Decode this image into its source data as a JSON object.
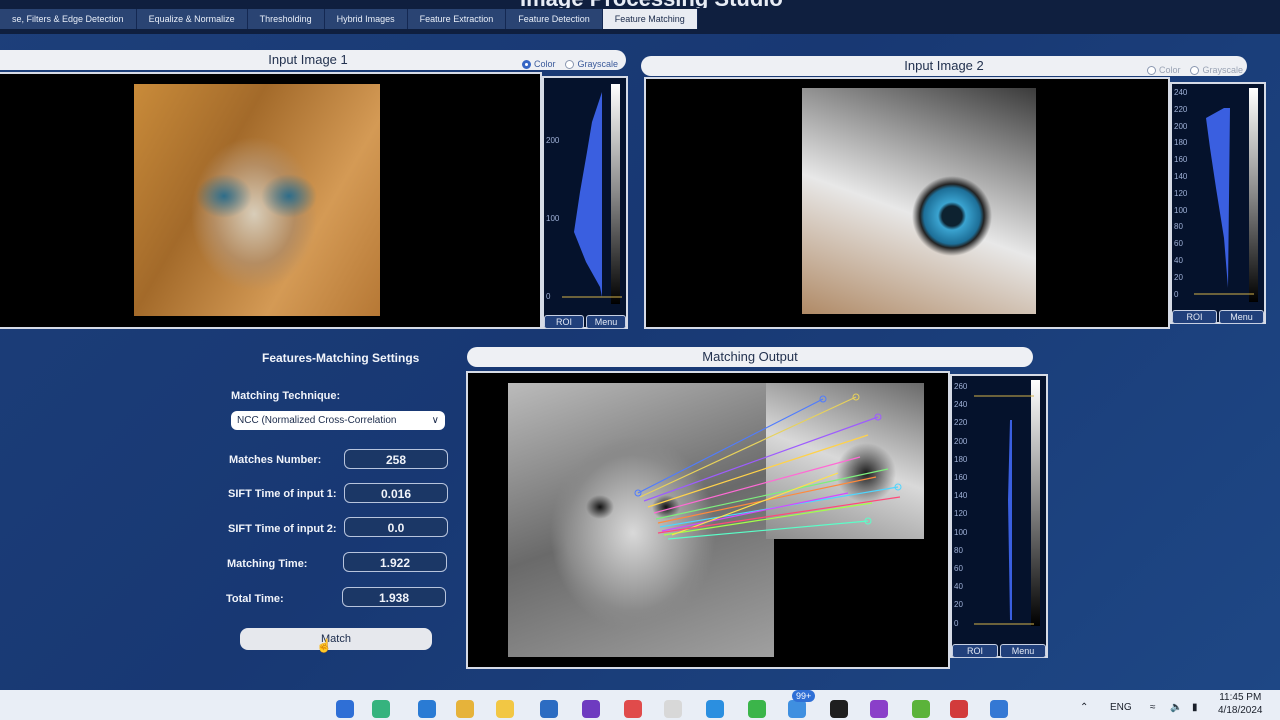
{
  "app": {
    "title": "Image Processing Studio"
  },
  "tabs": [
    {
      "label": "se, Filters & Edge Detection"
    },
    {
      "label": "Equalize & Normalize"
    },
    {
      "label": "Thresholding"
    },
    {
      "label": "Hybrid Images"
    },
    {
      "label": "Feature Extraction"
    },
    {
      "label": "Feature Detection"
    },
    {
      "label": "Feature Matching"
    }
  ],
  "input1": {
    "title": "Input Image 1",
    "color_label": "Color",
    "grayscale_label": "Grayscale",
    "histo_ticks": [
      "200",
      "100",
      "0"
    ],
    "roi_label": "ROI",
    "menu_label": "Menu"
  },
  "input2": {
    "title": "Input Image 2",
    "color_label": "Color",
    "grayscale_label": "Grayscale",
    "histo_ticks": [
      "240",
      "220",
      "200",
      "180",
      "160",
      "140",
      "120",
      "100",
      "80",
      "60",
      "40",
      "20",
      "0"
    ],
    "roi_label": "ROI",
    "menu_label": "Menu"
  },
  "settings": {
    "title": "Features-Matching Settings",
    "technique_label": "Matching Technique:",
    "technique_value": "NCC (Normalized Cross-Correlation",
    "matches_label": "Matches Number:",
    "matches_value": "258",
    "sift1_label": "SIFT Time of input 1:",
    "sift1_value": "0.016",
    "sift2_label": "SIFT Time of input 2:",
    "sift2_value": "0.0",
    "matching_time_label": "Matching Time:",
    "matching_time_value": "1.922",
    "total_time_label": "Total Time:",
    "total_time_value": "1.938",
    "match_button": "Match"
  },
  "output": {
    "title": "Matching Output",
    "histo_ticks": [
      "260",
      "240",
      "220",
      "200",
      "180",
      "160",
      "140",
      "120",
      "100",
      "80",
      "60",
      "40",
      "20",
      "0"
    ],
    "roi_label": "ROI",
    "menu_label": "Menu"
  },
  "taskbar": {
    "badge": "99+",
    "lang": "ENG",
    "time": "11:45 PM",
    "date": "4/18/2024"
  }
}
